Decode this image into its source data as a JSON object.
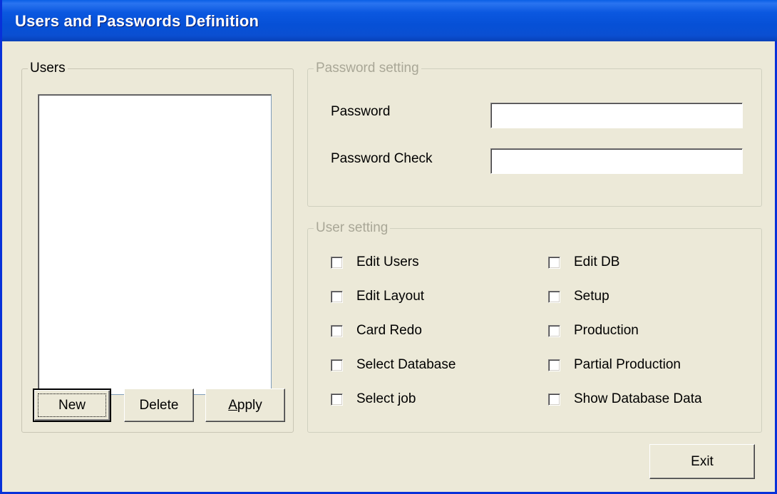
{
  "window": {
    "title": "Users and Passwords Definition"
  },
  "users_group": {
    "legend": "Users",
    "items": [],
    "buttons": {
      "new": "New",
      "delete": "Delete",
      "apply": "Apply",
      "apply_accel": "A"
    }
  },
  "password_group": {
    "legend": "Password setting",
    "password_label": "Password",
    "password_value": "",
    "check_label": "Password Check",
    "check_value": ""
  },
  "user_setting_group": {
    "legend": "User setting",
    "left": [
      {
        "label": "Edit Users",
        "checked": false
      },
      {
        "label": "Edit Layout",
        "checked": false
      },
      {
        "label": "Card Redo",
        "checked": false
      },
      {
        "label": "Select Database",
        "checked": false
      },
      {
        "label": "Select job",
        "checked": false
      }
    ],
    "right": [
      {
        "label": "Edit DB",
        "checked": false
      },
      {
        "label": "Setup",
        "checked": false
      },
      {
        "label": "Production",
        "checked": false
      },
      {
        "label": "Partial Production",
        "checked": false
      },
      {
        "label": "Show Database Data",
        "checked": false
      }
    ]
  },
  "footer": {
    "exit": "Exit"
  }
}
